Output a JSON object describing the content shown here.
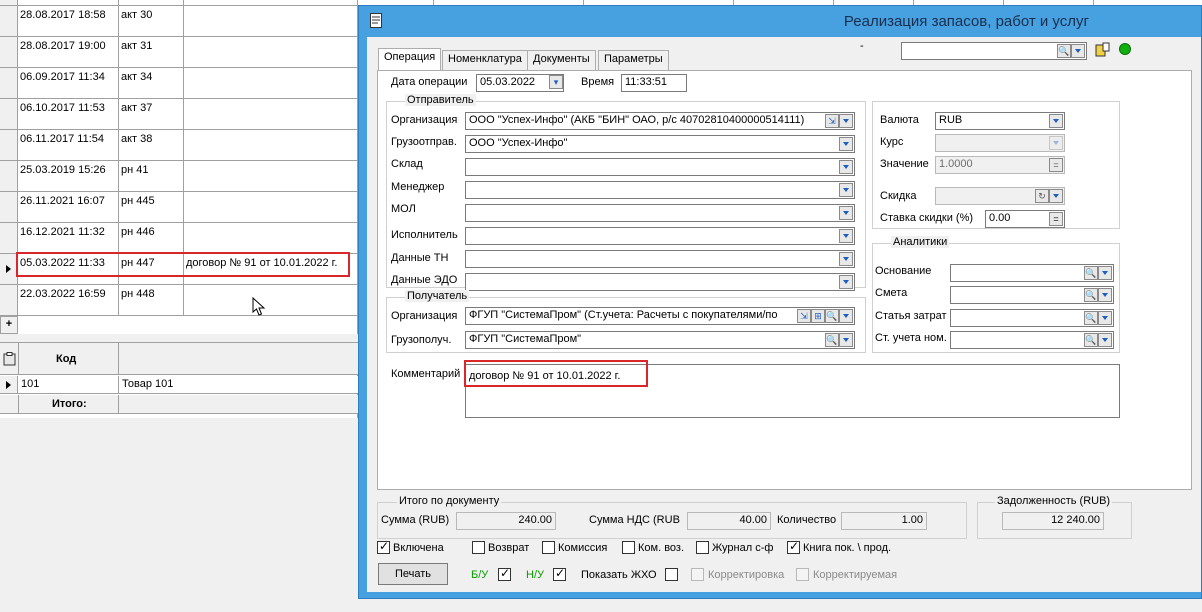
{
  "grid": {
    "rows": [
      {
        "date": "28.08.2017 18:58",
        "doc": "акт 30",
        "comment": ""
      },
      {
        "date": "28.08.2017 19:00",
        "doc": "акт 31",
        "comment": ""
      },
      {
        "date": "06.09.2017 11:34",
        "doc": "акт 34",
        "comment": ""
      },
      {
        "date": "06.10.2017 11:53",
        "doc": "акт 37",
        "comment": ""
      },
      {
        "date": "06.11.2017 11:54",
        "doc": "акт 38",
        "comment": ""
      },
      {
        "date": "25.03.2019 15:26",
        "doc": "рн 41",
        "comment": ""
      },
      {
        "date": "26.11.2021 16:07",
        "doc": "рн 445",
        "comment": ""
      },
      {
        "date": "16.12.2021 11:32",
        "doc": "рн 446",
        "comment": ""
      },
      {
        "date": "05.03.2022 11:33",
        "doc": "рн 447",
        "comment": "договор № 91 от 10.01.2022 г."
      },
      {
        "date": "22.03.2022 16:59",
        "doc": "рн 448",
        "comment": ""
      }
    ],
    "add_symbol": "+"
  },
  "items": {
    "header_code": "Код",
    "row": {
      "code": "101",
      "name": "Товар 101"
    },
    "total_label": "Итого:"
  },
  "dialog": {
    "title": "Реализация запасов, работ и услуг",
    "dash": "-",
    "tabs": [
      "Операция",
      "Номенклатура",
      "Документы",
      "Параметры"
    ],
    "op_date_label": "Дата операции",
    "op_date": "05.03.2022",
    "time_label": "Время",
    "time": "11:33:51",
    "sender": {
      "title": "Отправитель",
      "org_label": "Организация",
      "org": "ООО \"Успех-Инфо\" (АКБ \"БИН\" ОАО, р/с 40702810400000514111)",
      "shipper_label": "Грузоотправ.",
      "shipper": "ООО \"Успех-Инфо\"",
      "warehouse_label": "Склад",
      "manager_label": "Менеджер",
      "mol_label": "МОЛ",
      "executor_label": "Исполнитель",
      "tn_label": "Данные ТН",
      "edo_label": "Данные ЭДО"
    },
    "receiver": {
      "title": "Получатель",
      "org_label": "Организация",
      "org": "ФГУП \"СистемаПром\" (Ст.учета: Расчеты с покупателями/по",
      "consignee_label": "Грузополуч.",
      "consignee": "ФГУП \"СистемаПром\""
    },
    "currency": {
      "label": "Валюта",
      "value": "RUB",
      "rate_label": "Курс",
      "value_label": "Значение",
      "value_num": "1.0000",
      "discount_label": "Скидка",
      "discount_rate_label": "Ставка скидки (%)",
      "discount_rate": "0.00"
    },
    "analytics": {
      "title": "Аналитики",
      "basis_label": "Основание",
      "estimate_label": "Смета",
      "cost_item_label": "Статья затрат",
      "account_label": "Ст. учета ном."
    },
    "comment_label": "Комментарий",
    "comment": "договор № 91 от 10.01.2022 г.",
    "totals": {
      "title": "Итого по документу",
      "sum_label": "Сумма (RUB)",
      "sum": "240.00",
      "vat_label": "Сумма НДС (RUB",
      "vat": "40.00",
      "qty_label": "Количество",
      "qty": "1.00"
    },
    "debt": {
      "title": "Задолженность (RUB)",
      "value": "12 240.00"
    },
    "checks": {
      "included": "Включена",
      "return": "Возврат",
      "commission": "Комиссия",
      "com_voz": "Ком. воз.",
      "journal": "Журнал с-ф",
      "book": "Книга пок. \\ прод."
    },
    "print_label": "Печать",
    "bu_label": "Б/У",
    "nu_label": "Н/У",
    "show_zho_label": "Показать ЖХО",
    "correction_label": "Корректировка",
    "corrected_label": "Корректируемая",
    "accent_green": "#0a9d00"
  }
}
